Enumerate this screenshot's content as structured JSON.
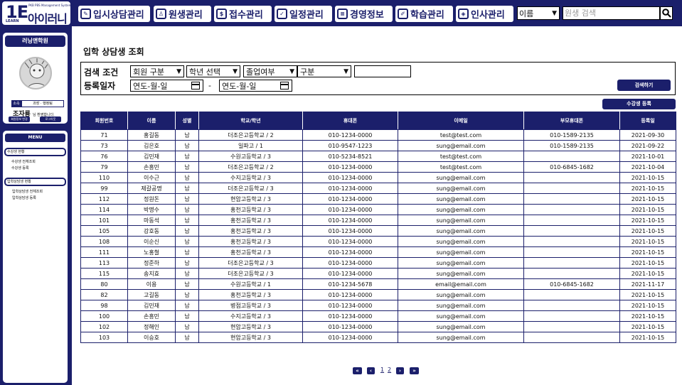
{
  "logo": {
    "mark": "1E",
    "sub": "LEARN",
    "tagline": "PKB PBS Management System",
    "name": "아이러니"
  },
  "nav": [
    {
      "label": "입시상담관리",
      "icon": "pencil-icon"
    },
    {
      "label": "원생관리",
      "icon": "person-icon"
    },
    {
      "label": "접수관리",
      "icon": "dollar-icon"
    },
    {
      "label": "일정관리",
      "icon": "check-icon"
    },
    {
      "label": "경영정보",
      "icon": "document-icon"
    },
    {
      "label": "학습관리",
      "icon": "edit-icon"
    },
    {
      "label": "인사관리",
      "icon": "tag-icon"
    }
  ],
  "search": {
    "select_value": "이름",
    "placeholder": "원생 검색"
  },
  "profile": {
    "header": "러닝앤학원",
    "dept_label": "소속",
    "dept_value": "과장 · 행정팀",
    "user_name": "조자룡",
    "user_suffix": "님 환영합니다.",
    "btn_edit": "회원정보 변경",
    "btn_logout": "로그아웃"
  },
  "menu": {
    "header": "MENU",
    "groups": [
      {
        "label": "수강생 현황",
        "items": [
          "수강생 전체조회",
          "수강생 등록"
        ]
      },
      {
        "label": "입학상담생 현황",
        "items": [
          "입학상담생 전체조회",
          "입학상담생 등록"
        ]
      }
    ]
  },
  "page_title": "입학 상담생 조회",
  "filter": {
    "search_label": "검색 조건",
    "date_label": "등록일자",
    "selects": [
      "회원 구분",
      "학년 선택",
      "졸업여부",
      "구분"
    ],
    "date_from": "연도-월-일",
    "date_to": "연도-월-일",
    "dash": "-",
    "search_button": "검색하기"
  },
  "register_button": "수강생 등록",
  "table": {
    "columns": [
      "회원번호",
      "이름",
      "성별",
      "학교/학년",
      "휴대폰",
      "이메일",
      "부모휴대폰",
      "등록일"
    ],
    "rows": [
      [
        "71",
        "홍길동",
        "남",
        "더조은고등학교 / 2",
        "010-1234-0000",
        "test@test.com",
        "010-1589-2135",
        "2021-09-30"
      ],
      [
        "73",
        "김은호",
        "남",
        "일파고 / 1",
        "010-9547-1223",
        "sung@email.com",
        "010-1589-2135",
        "2021-09-22"
      ],
      [
        "76",
        "김민재",
        "남",
        "수원고등학교 / 3",
        "010-5234-8521",
        "test@test.com",
        "",
        "2021-10-01"
      ],
      [
        "79",
        "손흥민",
        "남",
        "더조은고등학교 / 2",
        "010-1234-0000",
        "test@test.com",
        "010-6845-1682",
        "2021-10-04"
      ],
      [
        "110",
        "이수근",
        "남",
        "수지고등학교 / 3",
        "010-1234-0000",
        "sung@email.com",
        "",
        "2021-10-15"
      ],
      [
        "99",
        "제갈공명",
        "남",
        "더조은고등학교 / 3",
        "010-1234-0000",
        "sung@email.com",
        "",
        "2021-10-15"
      ],
      [
        "112",
        "정원돈",
        "남",
        "현암고등학교 / 3",
        "010-1234-0000",
        "sung@email.com",
        "",
        "2021-10-15"
      ],
      [
        "114",
        "박명수",
        "남",
        "홍천고등학교 / 3",
        "010-1234-0000",
        "sung@email.com",
        "",
        "2021-10-15"
      ],
      [
        "101",
        "마동석",
        "남",
        "홍천고등학교 / 3",
        "010-1234-0000",
        "sung@email.com",
        "",
        "2021-10-15"
      ],
      [
        "105",
        "강호동",
        "남",
        "홍천고등학교 / 3",
        "010-1234-0000",
        "sung@email.com",
        "",
        "2021-10-15"
      ],
      [
        "108",
        "이순신",
        "남",
        "홍천고등학교 / 3",
        "010-1234-0000",
        "sung@email.com",
        "",
        "2021-10-15"
      ],
      [
        "111",
        "노홍철",
        "남",
        "홍천고등학교 / 3",
        "010-1234-0000",
        "sung@email.com",
        "",
        "2021-10-15"
      ],
      [
        "113",
        "정준하",
        "남",
        "더조은고등학교 / 3",
        "010-1234-0000",
        "sung@email.com",
        "",
        "2021-10-15"
      ],
      [
        "115",
        "송지효",
        "남",
        "더조은고등학교 / 3",
        "010-1234-0000",
        "sung@email.com",
        "",
        "2021-10-15"
      ],
      [
        "80",
        "이용",
        "남",
        "수원고등학교 / 1",
        "010-1234-5678",
        "email@email.com",
        "010-6845-1682",
        "2021-11-17"
      ],
      [
        "82",
        "고길동",
        "남",
        "홍천고등학교 / 3",
        "010-1234-0000",
        "sung@email.com",
        "",
        "2021-10-15"
      ],
      [
        "98",
        "김민재",
        "남",
        "병점고등학교 / 3",
        "010-1234-0000",
        "sung@email.com",
        "",
        "2021-10-15"
      ],
      [
        "100",
        "손흥민",
        "남",
        "수지고등학교 / 3",
        "010-1234-0000",
        "sung@email.com",
        "",
        "2021-10-15"
      ],
      [
        "102",
        "정해인",
        "남",
        "현암고등학교 / 3",
        "010-1234-0000",
        "sung@email.com",
        "",
        "2021-10-15"
      ],
      [
        "103",
        "이승호",
        "남",
        "현암고등학교 / 3",
        "010-1234-0000",
        "sung@email.com",
        "",
        "2021-10-15"
      ]
    ]
  },
  "pagination": {
    "first": "«",
    "prev": "‹",
    "pages": [
      "1",
      "2"
    ],
    "next": "›",
    "last": "»"
  },
  "colors": {
    "primary": "#1b1f6b",
    "background": "#ffffff"
  }
}
